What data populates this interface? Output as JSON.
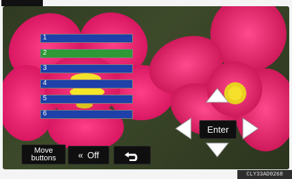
{
  "rows": [
    {
      "label": "1",
      "color": "#1e40a8"
    },
    {
      "label": "2",
      "color": "#2d9a35"
    },
    {
      "label": "3",
      "color": "#1e40a8"
    },
    {
      "label": "4",
      "color": "#1e40a8"
    },
    {
      "label": "5",
      "color": "#1e40a8"
    },
    {
      "label": "6",
      "color": "#1e40a8"
    }
  ],
  "buttons": {
    "move_line1": "Move",
    "move_line2": "buttons",
    "off_chevron": "«",
    "off_label": "Off",
    "enter_label": "Enter"
  },
  "icons": {
    "up": "arrow-up-icon",
    "down": "arrow-down-icon",
    "left": "arrow-left-icon",
    "right": "arrow-right-icon",
    "back": "return-icon"
  },
  "watermark": "CLY33AD0268"
}
